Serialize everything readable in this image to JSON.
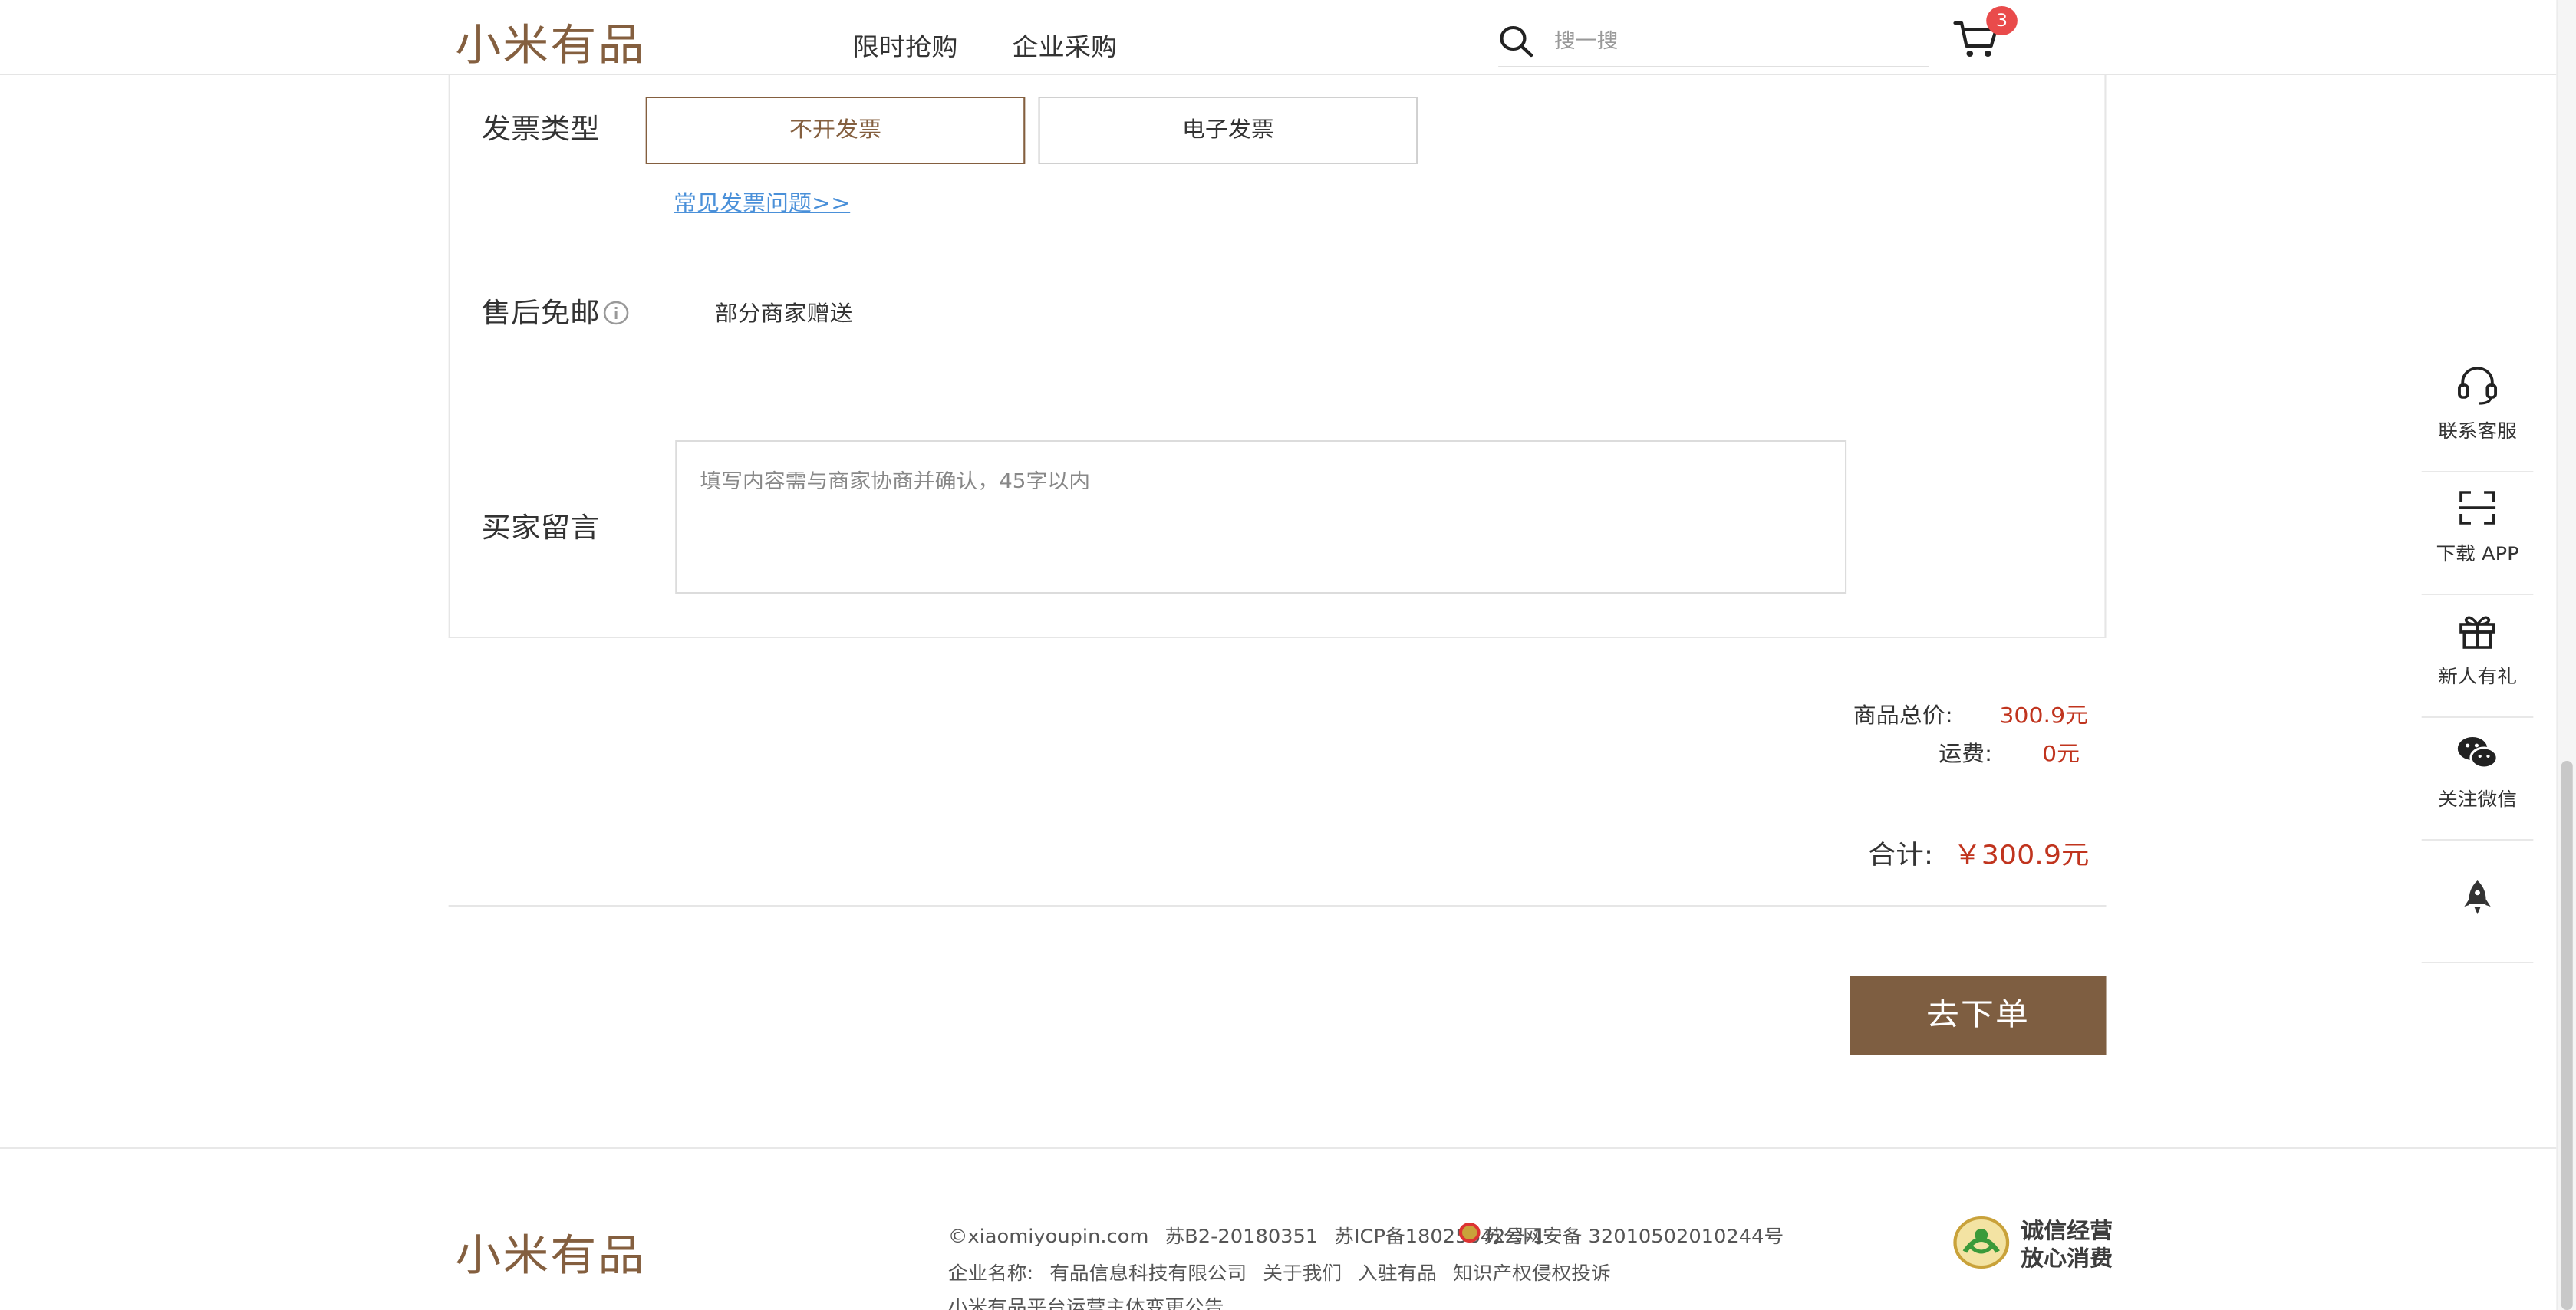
{
  "header": {
    "logo": "小米有品",
    "nav": [
      "限时抢购",
      "企业采购"
    ],
    "search_placeholder": "搜一搜",
    "cart_count": "3"
  },
  "invoice": {
    "label": "发票类型",
    "options": [
      "不开发票",
      "电子发票"
    ],
    "selected_index": 0,
    "faq_link": "常见发票问题>>"
  },
  "after_sale": {
    "label": "售后免邮",
    "value": "部分商家赠送"
  },
  "buyer_note": {
    "label": "买家留言",
    "placeholder": "填写内容需与商家协商并确认，45字以内"
  },
  "summary": {
    "goods_total_label": "商品总价:",
    "goods_total_value": "300.9元",
    "shipping_label": "运费:",
    "shipping_value": "0元",
    "total_label": "合计:",
    "total_value": "￥300.9元"
  },
  "order_button": "去下单",
  "rail": [
    "联系客服",
    "下载 APP",
    "新人有礼",
    "关注微信"
  ],
  "footer": {
    "logo": "小米有品",
    "line1": [
      "©xiaomiyoupin.com",
      "苏B2-20180351",
      "苏ICP备18025642号-1"
    ],
    "police": "苏公网安备 32010502010244号",
    "line2": [
      "企业名称:",
      "有品信息科技有限公司",
      "关于我们",
      "入驻有品",
      "知识产权侵权投诉"
    ],
    "line3": "小米有品平台运营主体变更公告",
    "trust": [
      "诚信经营",
      "放心消费"
    ]
  },
  "colors": {
    "brand": "#845f3f",
    "price": "#c0341e",
    "order_button": "#7e5e41",
    "link": "#4a90d9",
    "badge": "#e94b4b"
  }
}
